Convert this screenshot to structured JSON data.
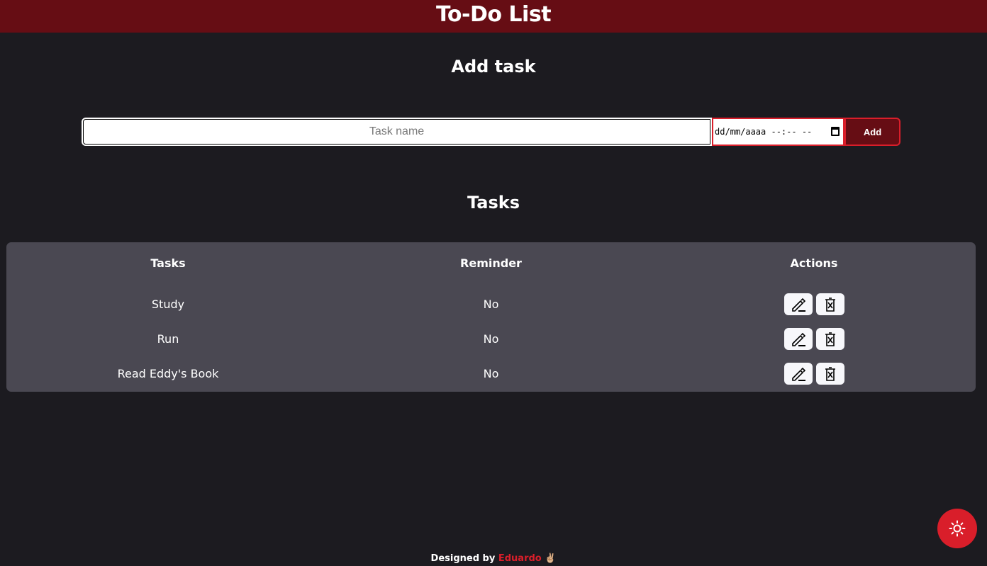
{
  "header": {
    "title": "To-Do List"
  },
  "add_section": {
    "title": "Add task",
    "task_input_placeholder": "Task name",
    "date_input_text": "dd/mm/aaaa --:-- --",
    "add_label": "Add"
  },
  "tasks_section": {
    "title": "Tasks",
    "columns": [
      "Tasks",
      "Reminder",
      "Actions"
    ],
    "rows": [
      {
        "task": "Study",
        "reminder": "No"
      },
      {
        "task": "Run",
        "reminder": "No"
      },
      {
        "task": "Read Eddy's Book",
        "reminder": "No"
      }
    ],
    "edit_icon": "pencil-edit-icon",
    "delete_icon": "trash-x-icon"
  },
  "footer": {
    "prefix": "Designed by",
    "author": "Eduardo",
    "emoji": "✌🏼"
  },
  "theme_toggle": {
    "icon": "sun-icon"
  },
  "colors": {
    "background": "#1c1b20",
    "header": "#660d14",
    "accent": "#d91e2a",
    "card": "#4a4852"
  }
}
